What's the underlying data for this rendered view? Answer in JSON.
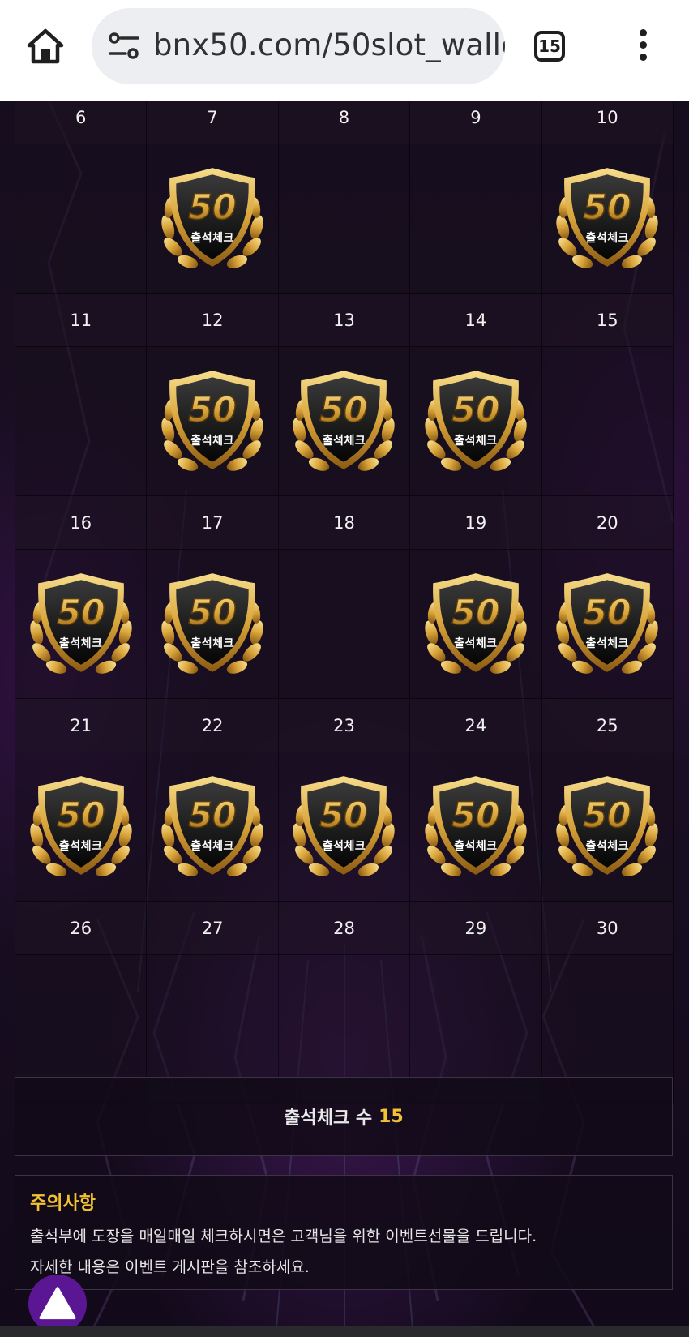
{
  "browser": {
    "url": "bnx50.com/50slot_walle",
    "tab_count": "15"
  },
  "calendar": {
    "rows": [
      {
        "days": [
          "6",
          "7",
          "8",
          "9",
          "10"
        ],
        "stamped": [
          false,
          true,
          false,
          false,
          true
        ]
      },
      {
        "days": [
          "11",
          "12",
          "13",
          "14",
          "15"
        ],
        "stamped": [
          false,
          true,
          true,
          true,
          false
        ]
      },
      {
        "days": [
          "16",
          "17",
          "18",
          "19",
          "20"
        ],
        "stamped": [
          true,
          true,
          false,
          true,
          true
        ]
      },
      {
        "days": [
          "21",
          "22",
          "23",
          "24",
          "25"
        ],
        "stamped": [
          true,
          true,
          true,
          true,
          true
        ]
      },
      {
        "days": [
          "26",
          "27",
          "28",
          "29",
          "30"
        ],
        "stamped": [
          false,
          false,
          false,
          false,
          false
        ]
      }
    ],
    "stamp": {
      "number": "50",
      "label": "출석체크",
      "gold": "#d9a43a",
      "gold_light": "#f6dd8c",
      "shield_dark": "#111111"
    }
  },
  "summary": {
    "label": "출석체크 수",
    "count": "15"
  },
  "notice": {
    "title": "주의사항",
    "line1": "출석부에 도장을 매일매일 체크하시면은 고객님을 위한 이벤트선물을 드립니다.",
    "line2": "자세한 내용은 이벤트 게시판을 참조하세요."
  },
  "colors": {
    "accent": "#f2c233",
    "fab": "#5b1793"
  },
  "icons": {
    "home": "home-icon",
    "site_info": "tune-icon",
    "menu": "more-vert-icon",
    "fab": "triangle-up-icon"
  }
}
